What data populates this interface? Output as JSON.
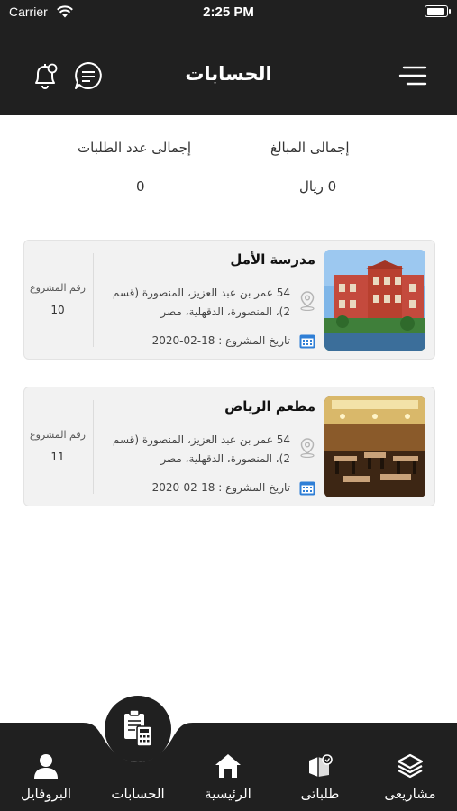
{
  "status_bar": {
    "carrier": "Carrier",
    "time": "2:25 PM"
  },
  "header": {
    "title": "الحسابات"
  },
  "totals": {
    "amount_label": "إجمالى المبالغ",
    "amount_value": "0 ريال",
    "count_label": "إجمالى عدد الطلبات",
    "count_value": "0"
  },
  "projects": [
    {
      "name": "مدرسة الأمل",
      "address": "54 عمر بن عبد العزيز، المنصورة (قسم 2)، المنصورة، الدقهلية، مصر",
      "date": "تاريخ المشروع : 18-02-2020",
      "number_label": "رقم المشروع",
      "number": "10"
    },
    {
      "name": "مطعم الرياض",
      "address": "54 عمر بن عبد العزيز، المنصورة (قسم 2)، المنصورة، الدقهلية، مصر",
      "date": "تاريخ المشروع : 18-02-2020",
      "number_label": "رقم المشروع",
      "number": "11"
    }
  ],
  "tabs": [
    {
      "label": "مشاريعى",
      "icon": "layers-icon"
    },
    {
      "label": "طلباتى",
      "icon": "package-icon"
    },
    {
      "label": "الرئيسية",
      "icon": "home-icon"
    },
    {
      "label": "الحسابات",
      "icon": "calculator-icon"
    },
    {
      "label": "البروفايل",
      "icon": "user-icon"
    }
  ],
  "colors": {
    "dark": "#202020",
    "card_bg": "#f2f2f2",
    "calendar_blue": "#2f7fd6"
  }
}
